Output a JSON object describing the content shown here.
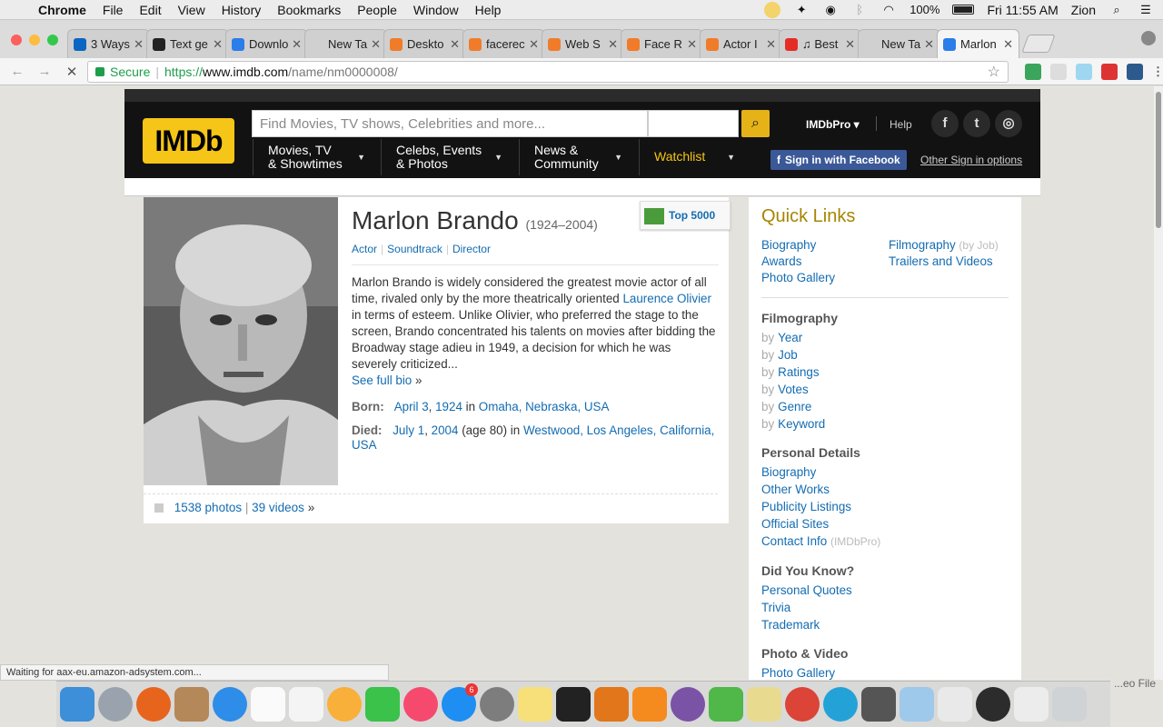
{
  "menubar": {
    "app": "Chrome",
    "items": [
      "File",
      "Edit",
      "View",
      "History",
      "Bookmarks",
      "People",
      "Window",
      "Help"
    ],
    "battery": "100%",
    "clock": "Fri 11:55 AM",
    "user": "Zion"
  },
  "tabs": [
    {
      "label": "3 Ways",
      "color": "#0a66c2"
    },
    {
      "label": "Text ge",
      "color": "#222222"
    },
    {
      "label": "Downlo",
      "color": "#2b7de9"
    },
    {
      "label": "New Tab",
      "color": "#d0d0d0"
    },
    {
      "label": "Deskto",
      "color": "#f07c2a"
    },
    {
      "label": "facerec",
      "color": "#f07c2a"
    },
    {
      "label": "Web S",
      "color": "#f07c2a"
    },
    {
      "label": "Face R",
      "color": "#f07c2a"
    },
    {
      "label": "Actor I",
      "color": "#f07c2a"
    },
    {
      "label": "♫ Best",
      "color": "#e52d27"
    },
    {
      "label": "New Tab",
      "color": "#d0d0d0"
    },
    {
      "label": "Marlon",
      "color": "#2b7de9",
      "active": true
    }
  ],
  "address": {
    "secure_label": "Secure",
    "proto": "https://",
    "host": "www.imdb.com",
    "path": "/name/nm0000008/"
  },
  "imdb": {
    "logo": "IMDb",
    "search_placeholder": "Find Movies, TV shows, Celebrities and more...",
    "imdbpro": "IMDbPro",
    "help": "Help",
    "nav": [
      {
        "line1": "Movies, TV",
        "line2": "& Showtimes"
      },
      {
        "line1": "Celebs, Events",
        "line2": "& Photos"
      },
      {
        "line1": "News &",
        "line2": "Community"
      }
    ],
    "watchlist": "Watchlist",
    "fb_signin": "Sign in with Facebook",
    "other_signin": "Other Sign in options"
  },
  "person": {
    "name": "Marlon Brando",
    "years": "(1924–2004)",
    "roles": [
      "Actor",
      "Soundtrack",
      "Director"
    ],
    "top_badge": "Top 5000",
    "bio_1": "Marlon Brando is widely considered the greatest movie actor of all time, rivaled only by the more theatrically oriented ",
    "bio_link": "Laurence Olivier",
    "bio_2": " in terms of esteem. Unlike Olivier, who preferred the stage to the screen, Brando concentrated his talents on movies after bidding the Broadway stage adieu in 1949, a decision for which he was severely criticized...",
    "see_full_bio": "See full bio",
    "born_label": "Born:",
    "born_date": "April 3",
    "born_year": "1924",
    "born_place": "Omaha, Nebraska, USA",
    "died_label": "Died:",
    "died_date": "July 1",
    "died_year": "2004",
    "died_age": "(age 80) in",
    "died_place": "Westwood, Los Angeles, California, USA",
    "photos": "1538 photos",
    "videos": "39 videos"
  },
  "sidebar": {
    "title": "Quick Links",
    "quick": [
      "Biography",
      "Filmography",
      "Awards",
      "Trailers and Videos",
      "Photo Gallery"
    ],
    "filmography_byjob": "(by Job)",
    "filmography_title": "Filmography",
    "filmography": [
      "Year",
      "Job",
      "Ratings",
      "Votes",
      "Genre",
      "Keyword"
    ],
    "by": "by",
    "personal_title": "Personal Details",
    "personal": [
      "Biography",
      "Other Works",
      "Publicity Listings",
      "Official Sites",
      "Contact Info"
    ],
    "contact_pro": "(IMDbPro)",
    "dyk_title": "Did You Know?",
    "dyk": [
      "Personal Quotes",
      "Trivia",
      "Trademark"
    ],
    "pv_title": "Photo & Video",
    "pv": [
      "Photo Gallery"
    ]
  },
  "status": "Waiting for aax-eu.amazon-adsystem.com...",
  "eo_file": "...eo File",
  "dock_badge": "6"
}
